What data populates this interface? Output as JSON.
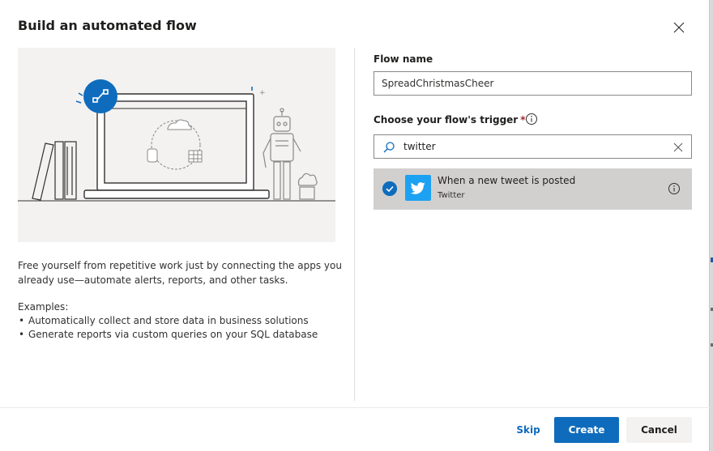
{
  "dialog": {
    "title": "Build an automated flow",
    "description": "Free yourself from repetitive work just by connecting the apps you already use—automate alerts, reports, and other tasks.",
    "examples_heading": "Examples:",
    "examples": [
      "Automatically collect and store data in business solutions",
      "Generate reports via custom queries on your SQL database"
    ]
  },
  "form": {
    "flow_name_label": "Flow name",
    "flow_name_value": "SpreadChristmasCheer",
    "trigger_label": "Choose your flow's trigger",
    "required_mark": "*",
    "search_value": "twitter"
  },
  "trigger_results": [
    {
      "title": "When a new tweet is posted",
      "connector": "Twitter",
      "selected": true
    }
  ],
  "footer": {
    "skip_label": "Skip",
    "create_label": "Create",
    "cancel_label": "Cancel"
  },
  "icons": {
    "close": "close-icon",
    "info": "info-icon",
    "search": "search-icon",
    "clear": "clear-icon",
    "check": "checkmark-icon",
    "twitter": "twitter-bird-icon"
  },
  "colors": {
    "accent": "#0f6cbd",
    "twitter": "#1da1f2",
    "selected_row": "#d2d0ce",
    "required": "#a4262c"
  }
}
